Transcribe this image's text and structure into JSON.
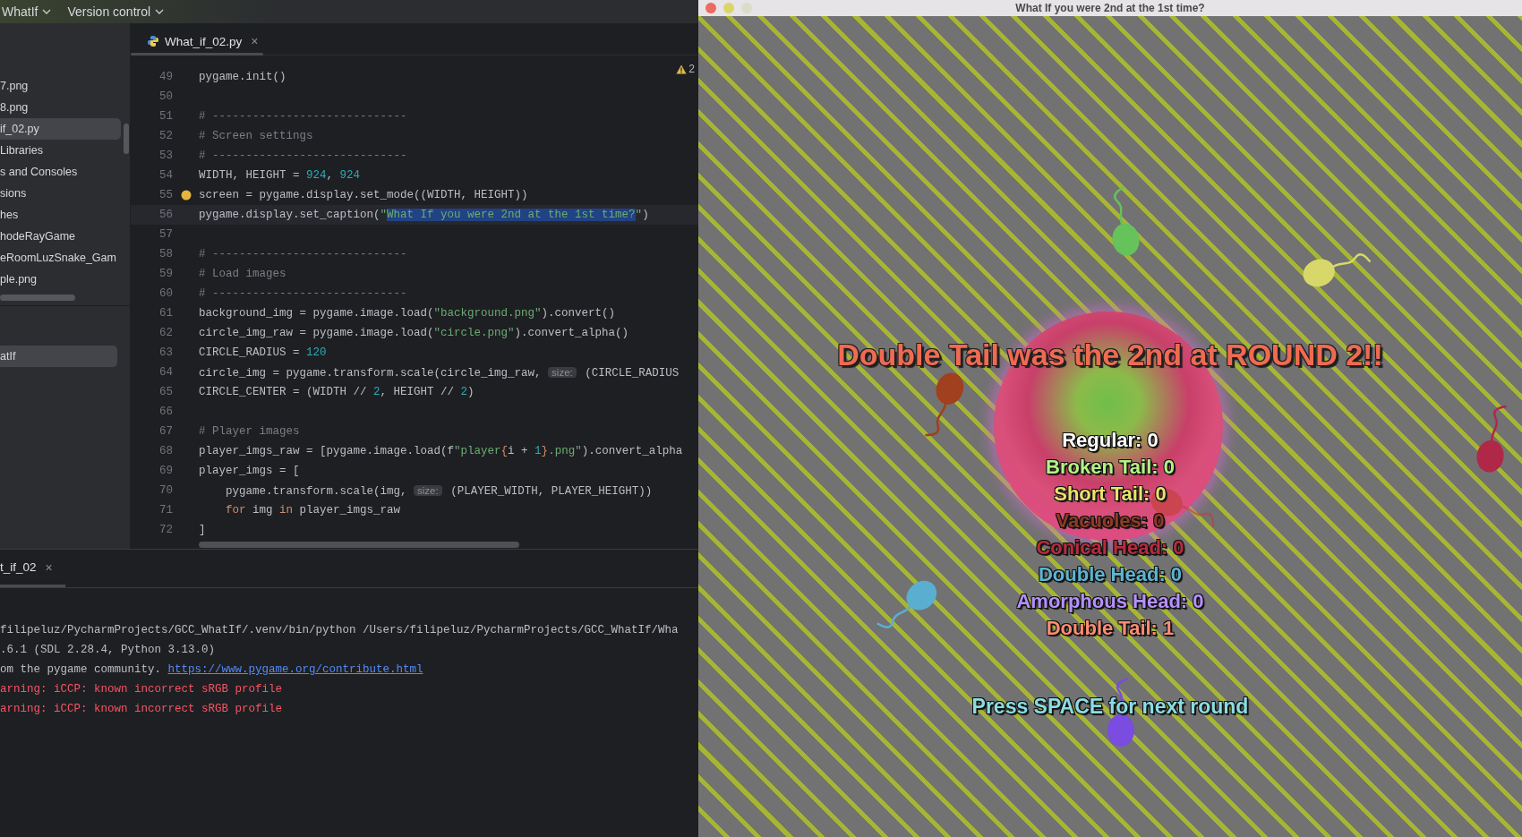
{
  "menu_bar": {
    "items": [
      {
        "label": "WhatIf"
      },
      {
        "label": "Version control"
      }
    ]
  },
  "project_tree": {
    "items": [
      {
        "label": "7.png",
        "selected": false
      },
      {
        "label": "8.png",
        "selected": false
      },
      {
        "label": "if_02.py",
        "selected": true
      },
      {
        "label": "Libraries",
        "selected": false
      },
      {
        "label": "s and Consoles",
        "selected": false
      },
      {
        "label": "sions",
        "selected": false
      },
      {
        "label": "hes",
        "selected": false
      },
      {
        "label": "hodeRayGame",
        "selected": false
      },
      {
        "label": "eRoomLuzSnake_Gam",
        "selected": false
      },
      {
        "label": "ple.png",
        "selected": false
      }
    ]
  },
  "structure": {
    "items": [
      {
        "label": "atIf",
        "selected": true
      }
    ]
  },
  "editor": {
    "tab": {
      "label": "What_if_02.py",
      "close": "×"
    },
    "warnings": "2",
    "lines": [
      {
        "number": "49",
        "current": false,
        "segments": [
          {
            "kind": "plain",
            "text": "pygame.init()"
          }
        ]
      },
      {
        "number": "50",
        "current": false
      },
      {
        "number": "51",
        "current": false,
        "segments": [
          {
            "kind": "comment",
            "text": "# -----------------------------"
          }
        ]
      },
      {
        "number": "52",
        "current": false,
        "segments": [
          {
            "kind": "comment",
            "text": "# Screen settings"
          }
        ]
      },
      {
        "number": "53",
        "current": false,
        "segments": [
          {
            "kind": "comment",
            "text": "# -----------------------------"
          }
        ]
      },
      {
        "number": "54",
        "current": false,
        "segments": [
          {
            "kind": "plain",
            "text": "WIDTH, HEIGHT = "
          },
          {
            "kind": "number",
            "text": "924"
          },
          {
            "kind": "plain",
            "text": ", "
          },
          {
            "kind": "number",
            "text": "924"
          }
        ]
      },
      {
        "number": "55",
        "current": false,
        "bulb": true,
        "segments": [
          {
            "kind": "plain",
            "text": "screen = pygame.display.set_mode((WIDTH, HEIGHT))"
          }
        ]
      },
      {
        "number": "56",
        "current": true,
        "segments": [
          {
            "kind": "plain",
            "text": "pygame.display.set_caption("
          },
          {
            "kind": "string",
            "text": "\""
          },
          {
            "kind": "selected",
            "text": "What If you were 2nd at the 1st time?"
          },
          {
            "kind": "string",
            "text": "\""
          },
          {
            "kind": "plain",
            "text": ")"
          }
        ]
      },
      {
        "number": "57",
        "current": false
      },
      {
        "number": "58",
        "current": false,
        "segments": [
          {
            "kind": "comment",
            "text": "# -----------------------------"
          }
        ]
      },
      {
        "number": "59",
        "current": false,
        "segments": [
          {
            "kind": "comment",
            "text": "# Load images"
          }
        ]
      },
      {
        "number": "60",
        "current": false,
        "segments": [
          {
            "kind": "comment",
            "text": "# -----------------------------"
          }
        ]
      },
      {
        "number": "61",
        "current": false,
        "segments": [
          {
            "kind": "plain",
            "text": "background_img = pygame.image.load("
          },
          {
            "kind": "string",
            "text": "\"background.png\""
          },
          {
            "kind": "plain",
            "text": ").convert()"
          }
        ]
      },
      {
        "number": "62",
        "current": false,
        "segments": [
          {
            "kind": "plain",
            "text": "circle_img_raw = pygame.image.load("
          },
          {
            "kind": "string",
            "text": "\"circle.png\""
          },
          {
            "kind": "plain",
            "text": ").convert_alpha()"
          }
        ]
      },
      {
        "number": "63",
        "current": false,
        "segments": [
          {
            "kind": "plain",
            "text": "CIRCLE_RADIUS = "
          },
          {
            "kind": "number",
            "text": "120"
          }
        ]
      },
      {
        "number": "64",
        "current": false,
        "segments": [
          {
            "kind": "plain",
            "text": "circle_img = pygame.transform.scale(circle_img_raw, "
          },
          {
            "kind": "hint",
            "text": "size:"
          },
          {
            "kind": "plain",
            "text": " (CIRCLE_RADIUS"
          }
        ]
      },
      {
        "number": "65",
        "current": false,
        "segments": [
          {
            "kind": "plain",
            "text": "CIRCLE_CENTER = (WIDTH // "
          },
          {
            "kind": "number",
            "text": "2"
          },
          {
            "kind": "plain",
            "text": ", HEIGHT // "
          },
          {
            "kind": "number",
            "text": "2"
          },
          {
            "kind": "plain",
            "text": ")"
          }
        ]
      },
      {
        "number": "66",
        "current": false
      },
      {
        "number": "67",
        "current": false,
        "segments": [
          {
            "kind": "comment",
            "text": "# Player images"
          }
        ]
      },
      {
        "number": "68",
        "current": false,
        "segments": [
          {
            "kind": "plain",
            "text": "player_imgs_raw = [pygame.image.load(f"
          },
          {
            "kind": "string",
            "text": "\"player"
          },
          {
            "kind": "brace",
            "text": "{"
          },
          {
            "kind": "plain",
            "text": "i + "
          },
          {
            "kind": "number",
            "text": "1"
          },
          {
            "kind": "brace",
            "text": "}"
          },
          {
            "kind": "string",
            "text": ".png\""
          },
          {
            "kind": "plain",
            "text": ").convert_alpha"
          }
        ]
      },
      {
        "number": "69",
        "current": false,
        "segments": [
          {
            "kind": "plain",
            "text": "player_imgs = ["
          }
        ]
      },
      {
        "number": "70",
        "current": false,
        "segments": [
          {
            "kind": "plain",
            "text": "    pygame.transform.scale(img, "
          },
          {
            "kind": "hint",
            "text": "size:"
          },
          {
            "kind": "plain",
            "text": " (PLAYER_WIDTH, PLAYER_HEIGHT))"
          }
        ]
      },
      {
        "number": "71",
        "current": false,
        "segments": [
          {
            "kind": "keyword",
            "text": "    for"
          },
          {
            "kind": "plain",
            "text": " img "
          },
          {
            "kind": "keyword",
            "text": "in"
          },
          {
            "kind": "plain",
            "text": " player_imgs_raw"
          }
        ]
      },
      {
        "number": "72",
        "current": false,
        "segments": [
          {
            "kind": "plain",
            "text": "]"
          }
        ]
      }
    ]
  },
  "console": {
    "tab": {
      "label": "t_if_02",
      "close": "×"
    },
    "lines": [
      {
        "segments": [
          {
            "kind": "plain",
            "text": "filipeluz/PycharmProjects/GCC_WhatIf/.venv/bin/python /Users/filipeluz/PycharmProjects/GCC_WhatIf/Wha"
          }
        ]
      },
      {
        "segments": [
          {
            "kind": "plain",
            "text": ".6.1 (SDL 2.28.4, Python 3.13.0)"
          }
        ]
      },
      {
        "segments": [
          {
            "kind": "plain",
            "text": "om the pygame community. "
          },
          {
            "kind": "link",
            "text": "https://www.pygame.org/contribute.html"
          }
        ]
      },
      {
        "segments": [
          {
            "kind": "error",
            "text": "arning: iCCP: known incorrect sRGB profile"
          }
        ]
      },
      {
        "segments": [
          {
            "kind": "error",
            "text": "arning: iCCP: known incorrect sRGB profile"
          }
        ]
      }
    ]
  },
  "game_window": {
    "title": "What If you were 2nd at the 1st time?",
    "headline": "Double Tail was the 2nd at ROUND 2!!",
    "scores": [
      {
        "text": "Regular: 0",
        "color": "#ffffff"
      },
      {
        "text": "Broken Tail: 0",
        "color": "#b4f284"
      },
      {
        "text": "Short Tail: 0",
        "color": "#e8e26e"
      },
      {
        "text": "Vacuoles: 0",
        "color": "#8c3c24"
      },
      {
        "text": "Conical Head: 0",
        "color": "#b42c3e"
      },
      {
        "text": "Double Head: 0",
        "color": "#5cb4d2"
      },
      {
        "text": "Amorphous Head: 0",
        "color": "#b690ff"
      },
      {
        "text": "Double Tail: 1",
        "color": "#ff8c72"
      }
    ],
    "prompt": "Press SPACE for next round"
  }
}
